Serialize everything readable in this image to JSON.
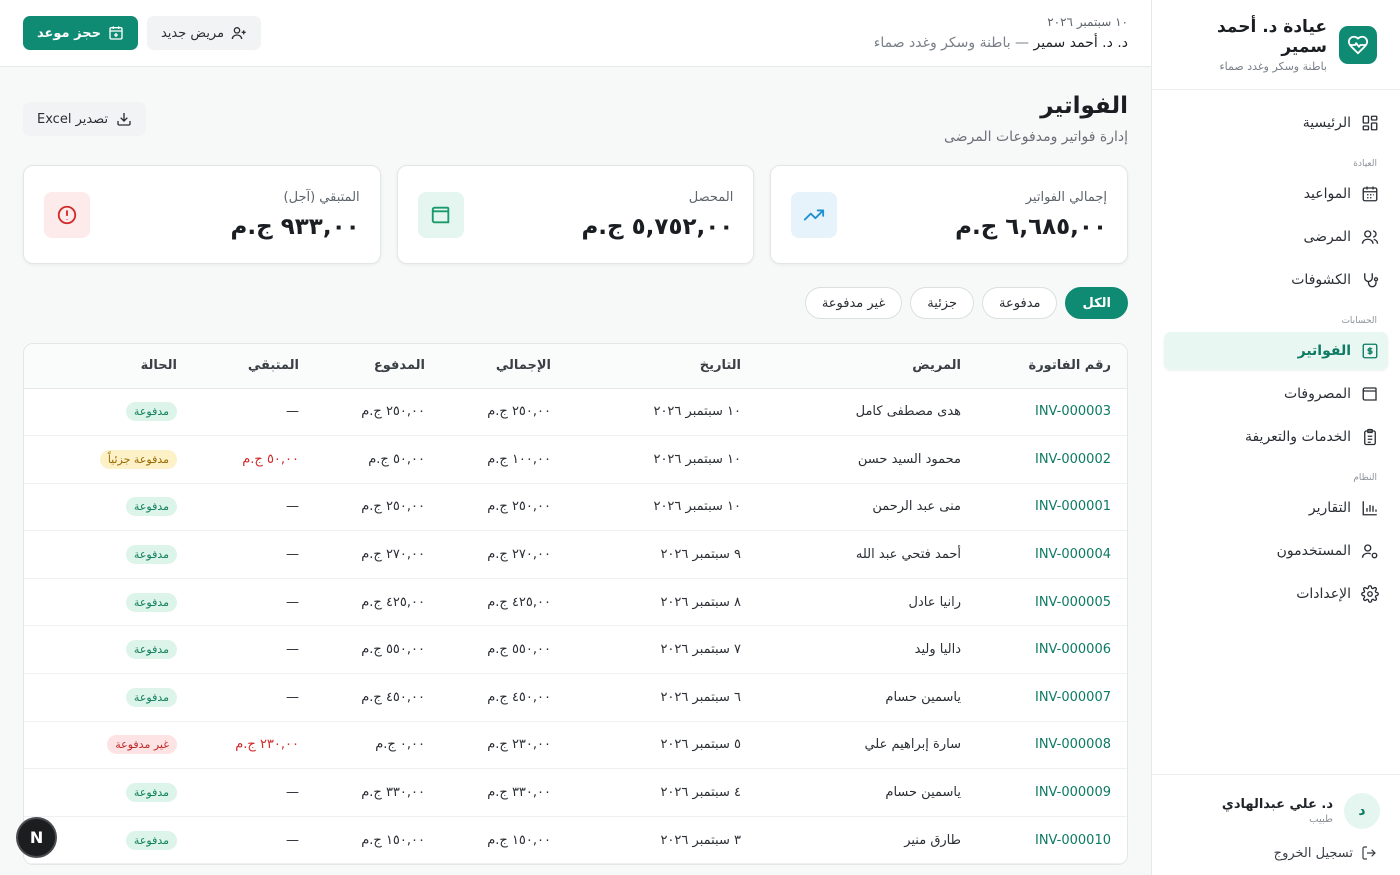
{
  "brand": {
    "title": "عيادة د. أحمد سمير",
    "subtitle": "باطنة وسكر وغدد صماء"
  },
  "nav": {
    "home": "الرئيسية",
    "section_clinic": "العيادة",
    "appointments": "المواعيد",
    "patients": "المرضى",
    "visits": "الكشوفات",
    "section_accounts": "الحسابات",
    "invoices": "الفواتير",
    "expenses": "المصروفات",
    "services": "الخدمات والتعريفة",
    "section_system": "النظام",
    "reports": "التقارير",
    "users": "المستخدمون",
    "settings": "الإعدادات"
  },
  "user": {
    "initial": "د",
    "name": "د. علي عبدالهادي",
    "role": "طبيب",
    "logout": "تسجيل الخروج"
  },
  "topbar": {
    "date": "١٠ سبتمبر ٢٠٢٦",
    "doctor": "د. د. أحمد سمير",
    "separator": " — ",
    "specialty": "باطنة وسكر وغدد صماء",
    "new_patient": "مريض جديد",
    "book": "حجز موعد"
  },
  "page": {
    "title": "الفواتير",
    "subtitle": "إدارة فواتير ومدفوعات المرضى",
    "export": "تصدير Excel"
  },
  "stats": [
    {
      "label": "إجمالي الفواتير",
      "value": "٦,٦٨٥,٠٠ ج.م"
    },
    {
      "label": "المحصل",
      "value": "٥,٧٥٢,٠٠ ج.م"
    },
    {
      "label": "المتبقي (آجل)",
      "value": "٩٣٣,٠٠ ج.م"
    }
  ],
  "colors": {
    "primary": "#0f8a73",
    "trend": "#1f8fd1",
    "paid": "#1a9a6c",
    "due": "#d12b2b"
  },
  "filters": [
    "الكل",
    "مدفوعة",
    "جزئية",
    "غير مدفوعة"
  ],
  "table": {
    "headers": [
      "رقم الفاتورة",
      "المريض",
      "التاريخ",
      "الإجمالي",
      "المدفوع",
      "المتبقي",
      "الحالة"
    ],
    "rows": [
      {
        "id": "INV-000003",
        "patient": "هدى مصطفى كامل",
        "date": "١٠ سبتمبر ٢٠٢٦",
        "total": "٢٥٠,٠٠ ج.م",
        "paid": "٢٥٠,٠٠ ج.م",
        "due": "—",
        "status": "مدفوعة",
        "status_type": "paid"
      },
      {
        "id": "INV-000002",
        "patient": "محمود السيد حسن",
        "date": "١٠ سبتمبر ٢٠٢٦",
        "total": "١٠٠,٠٠ ج.م",
        "paid": "٥٠,٠٠ ج.م",
        "due": "٥٠,٠٠ ج.م",
        "status": "مدفوعة جزئياً",
        "status_type": "partial"
      },
      {
        "id": "INV-000001",
        "patient": "منى عبد الرحمن",
        "date": "١٠ سبتمبر ٢٠٢٦",
        "total": "٢٥٠,٠٠ ج.م",
        "paid": "٢٥٠,٠٠ ج.م",
        "due": "—",
        "status": "مدفوعة",
        "status_type": "paid"
      },
      {
        "id": "INV-000004",
        "patient": "أحمد فتحي عبد الله",
        "date": "٩ سبتمبر ٢٠٢٦",
        "total": "٢٧٠,٠٠ ج.م",
        "paid": "٢٧٠,٠٠ ج.م",
        "due": "—",
        "status": "مدفوعة",
        "status_type": "paid"
      },
      {
        "id": "INV-000005",
        "patient": "رانيا عادل",
        "date": "٨ سبتمبر ٢٠٢٦",
        "total": "٤٢٥,٠٠ ج.م",
        "paid": "٤٢٥,٠٠ ج.م",
        "due": "—",
        "status": "مدفوعة",
        "status_type": "paid"
      },
      {
        "id": "INV-000006",
        "patient": "داليا وليد",
        "date": "٧ سبتمبر ٢٠٢٦",
        "total": "٥٥٠,٠٠ ج.م",
        "paid": "٥٥٠,٠٠ ج.م",
        "due": "—",
        "status": "مدفوعة",
        "status_type": "paid"
      },
      {
        "id": "INV-000007",
        "patient": "ياسمين حسام",
        "date": "٦ سبتمبر ٢٠٢٦",
        "total": "٤٥٠,٠٠ ج.م",
        "paid": "٤٥٠,٠٠ ج.م",
        "due": "—",
        "status": "مدفوعة",
        "status_type": "paid"
      },
      {
        "id": "INV-000008",
        "patient": "سارة إبراهيم علي",
        "date": "٥ سبتمبر ٢٠٢٦",
        "total": "٢٣٠,٠٠ ج.م",
        "paid": "٠,٠٠ ج.م",
        "due": "٢٣٠,٠٠ ج.م",
        "status": "غير مدفوعة",
        "status_type": "unpaid"
      },
      {
        "id": "INV-000009",
        "patient": "ياسمين حسام",
        "date": "٤ سبتمبر ٢٠٢٦",
        "total": "٣٣٠,٠٠ ج.م",
        "paid": "٣٣٠,٠٠ ج.م",
        "due": "—",
        "status": "مدفوعة",
        "status_type": "paid"
      },
      {
        "id": "INV-000010",
        "patient": "طارق منير",
        "date": "٣ سبتمبر ٢٠٢٦",
        "total": "١٥٠,٠٠ ج.م",
        "paid": "١٥٠,٠٠ ج.م",
        "due": "—",
        "status": "مدفوعة",
        "status_type": "paid"
      }
    ]
  },
  "dev_badge": "N"
}
